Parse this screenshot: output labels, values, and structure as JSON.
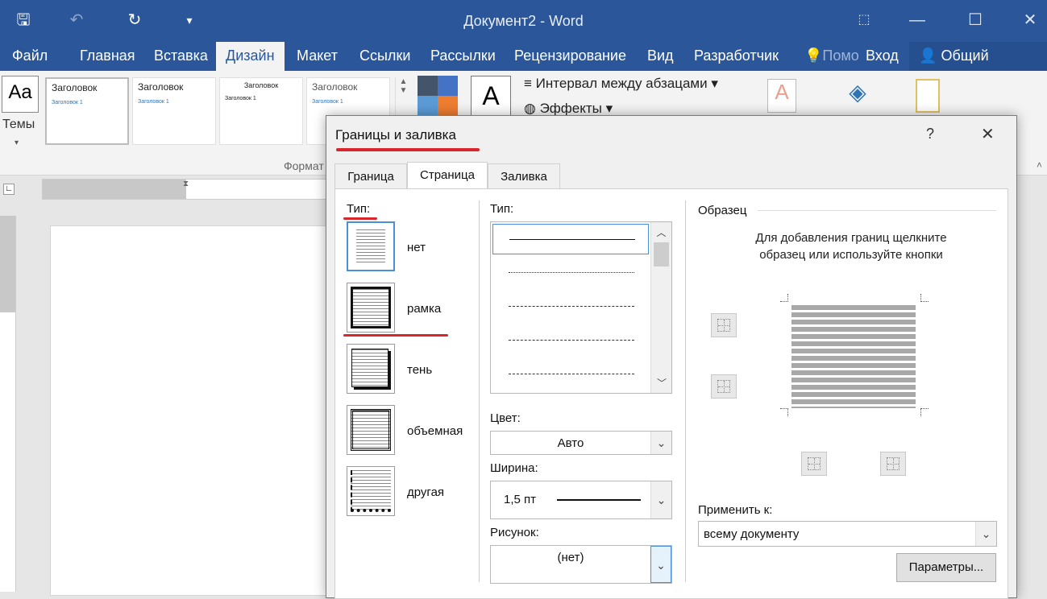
{
  "window": {
    "title": "Документ2 - Word"
  },
  "tabs": [
    "Файл",
    "Главная",
    "Вставка",
    "Дизайн",
    "Макет",
    "Ссылки",
    "Рассылки",
    "Рецензирование",
    "Вид",
    "Разработчик",
    "Помо",
    "Вход",
    "Общий доступ"
  ],
  "ribbon": {
    "themes_label": "Темы",
    "theme_letters": "Aa",
    "styles": [
      {
        "heading": "Заголовок",
        "sub": "Заголовок 1"
      },
      {
        "heading": "Заголовок",
        "sub": "Заголовок 1"
      },
      {
        "heading": "Заголовок",
        "sub": "Заголовок 1"
      },
      {
        "heading": "Заголовок",
        "sub": "Заголовок 1"
      }
    ],
    "font_letter": "A",
    "spacing": "Интервал между абзацами",
    "effects": "Эффекты",
    "group_label": "Формат"
  },
  "dialog": {
    "title": "Границы и заливка",
    "help": "?",
    "close": "✕",
    "tabs": [
      "Граница",
      "Страница",
      "Заливка"
    ],
    "active_tab": "Страница",
    "type_label": "Тип:",
    "types": [
      "нет",
      "рамка",
      "тень",
      "объемная",
      "другая"
    ],
    "line_type_label": "Тип:",
    "color_label": "Цвет:",
    "color_value": "Авто",
    "width_label": "Ширина:",
    "width_value": "1,5 пт",
    "art_label": "Рисунок:",
    "art_value": "(нет)",
    "preview_label": "Образец",
    "preview_hint_1": "Для добавления границ щелкните",
    "preview_hint_2": "образец или используйте кнопки",
    "apply_label": "Применить к:",
    "apply_value": "всему документу",
    "options_button": "Параметры..."
  }
}
